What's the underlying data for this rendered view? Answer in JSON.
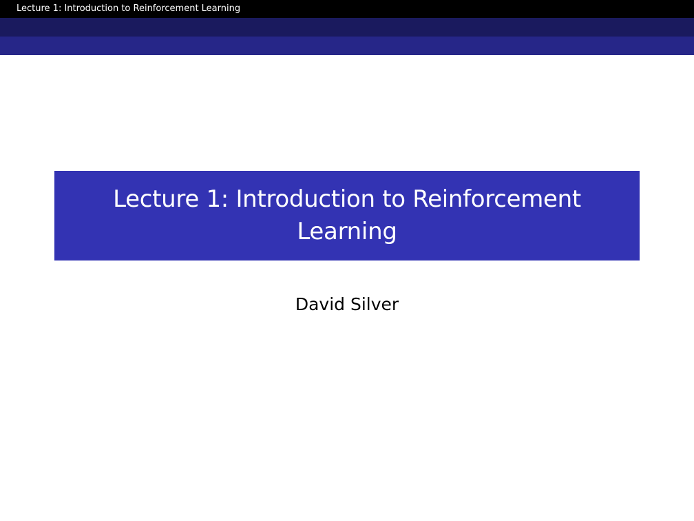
{
  "header": {
    "running_title": "Lecture 1: Introduction to Reinforcement Learning"
  },
  "slide": {
    "title": "Lecture 1: Introduction to Reinforcement Learning",
    "author": "David Silver"
  },
  "colors": {
    "headline_background": "#000000",
    "band_dark": "#1a1a5e",
    "band_mid": "#262688",
    "title_box": "#3333b3",
    "title_text": "#ffffff",
    "author_text": "#000000"
  }
}
